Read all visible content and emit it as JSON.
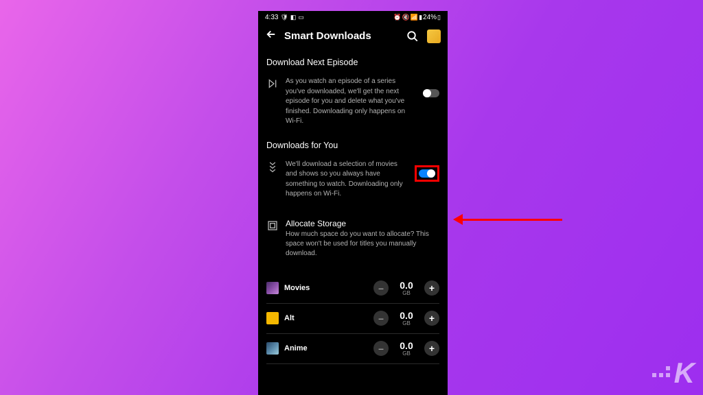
{
  "status_bar": {
    "time": "4:33",
    "battery": "24%"
  },
  "header": {
    "title": "Smart Downloads"
  },
  "sections": {
    "next_episode": {
      "title": "Download Next Episode",
      "description": "As you watch an episode of a series you've downloaded, we'll get the next episode for you and delete what you've finished. Downloading only happens on Wi-Fi.",
      "toggle_on": false
    },
    "for_you": {
      "title": "Downloads for You",
      "description": "We'll download a selection of movies and shows so you always have something to watch. Downloading only happens on Wi-Fi.",
      "toggle_on": true
    },
    "allocate": {
      "title": "Allocate Storage",
      "description": "How much space do you want to allocate? This space won't be used for titles you manually download."
    }
  },
  "storage_items": [
    {
      "name": "Movies",
      "value": "0.0",
      "unit": "GB"
    },
    {
      "name": "Alt",
      "value": "0.0",
      "unit": "GB"
    },
    {
      "name": "Anime",
      "value": "0.0",
      "unit": "GB"
    }
  ],
  "icons": {
    "minus": "–",
    "plus": "+"
  },
  "watermark": "K"
}
